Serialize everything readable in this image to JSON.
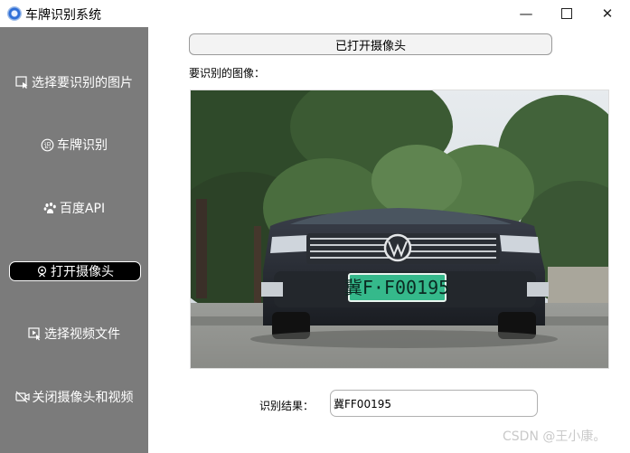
{
  "window": {
    "title": "车牌识别系统",
    "minimize_glyph": "—",
    "close_glyph": "✕",
    "icon": "app-icon"
  },
  "sidebar": {
    "items": [
      {
        "label": "选择要识别的图片",
        "icon": "select-image-icon",
        "active": false
      },
      {
        "label": "车牌识别",
        "icon": "recognize-icon",
        "active": false
      },
      {
        "label": "百度API",
        "icon": "paw-icon",
        "active": false
      },
      {
        "label": "打开摄像头",
        "icon": "camera-icon",
        "active": true
      },
      {
        "label": "选择视频文件",
        "icon": "select-video-icon",
        "active": false
      },
      {
        "label": "关闭摄像头和视频",
        "icon": "video-off-icon",
        "active": false
      }
    ]
  },
  "main": {
    "camera_status_button": "已打开摄像头",
    "image_label": "要识别的图像：",
    "result_label": "识别结果：",
    "result_value": "冀FF00195"
  },
  "photo": {
    "plate_text": "冀F·F00195"
  },
  "watermark": "CSDN @王小康。",
  "colors": {
    "sidebar_bg": "#7b7b7b",
    "active_item_bg": "#000000",
    "plate_green": "#35b98b"
  }
}
